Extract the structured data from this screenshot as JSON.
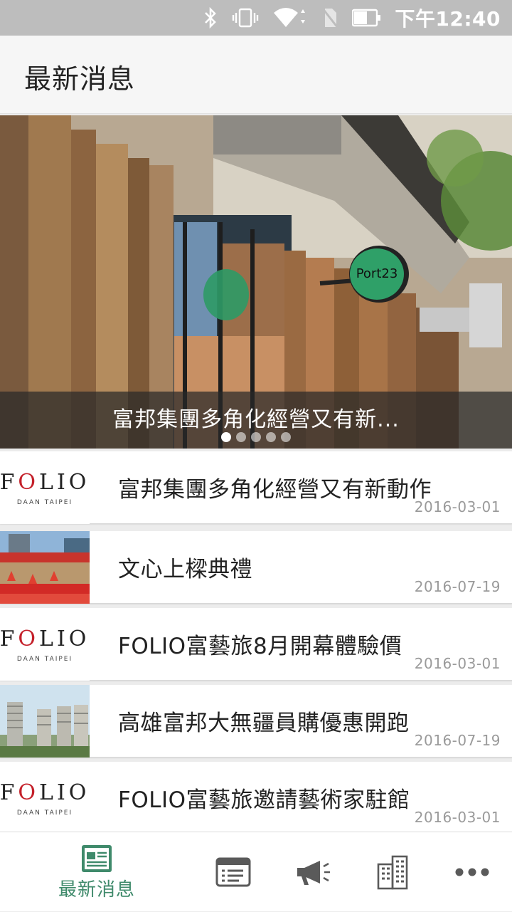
{
  "status_bar": {
    "time": "下午12:40",
    "icons": [
      "bluetooth-icon",
      "vibrate-icon",
      "wifi-icon",
      "no-sim-icon",
      "battery-icon"
    ]
  },
  "app_bar": {
    "title": "最新消息"
  },
  "hero": {
    "caption": "富邦集團多角化經營又有新...",
    "slide_count": 5,
    "active_slide": 1
  },
  "news": [
    {
      "title": "富邦集團多角化經營又有新動作",
      "date": "2016-03-01",
      "thumb": "folio-logo"
    },
    {
      "title": "文心上樑典禮",
      "date": "2016-07-19",
      "thumb": "ceremony-photo"
    },
    {
      "title": "FOLIO富藝旅8月開幕體驗價",
      "date": "2016-03-01",
      "thumb": "folio-logo"
    },
    {
      "title": "高雄富邦大無疆員購優惠開跑",
      "date": "2016-07-19",
      "thumb": "towers-photo"
    },
    {
      "title": "FOLIO富藝旅邀請藝術家駐館",
      "date": "2016-03-01",
      "thumb": "folio-logo"
    }
  ],
  "folio_logo": {
    "word": "FOLIO",
    "sub": "DAAN TAIPEI"
  },
  "tab_bar": {
    "active_label": "最新消息",
    "tabs": [
      "newspaper-icon",
      "list-card-icon",
      "megaphone-icon",
      "building-icon",
      "more-icon"
    ]
  },
  "colors": {
    "accent": "#3f8a6b",
    "status_bar": "#bdbdbd",
    "folio_red": "#c4202a"
  }
}
